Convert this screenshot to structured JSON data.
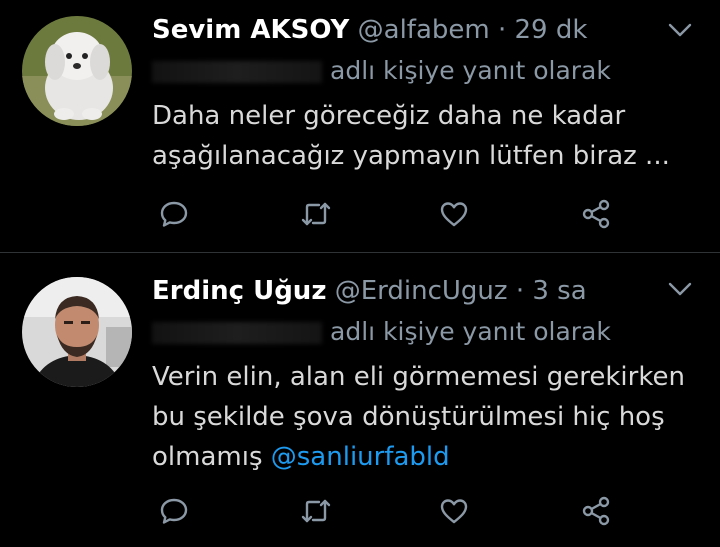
{
  "tweets": [
    {
      "name": "Sevim AKSOY",
      "handle": "@alfabem",
      "time": "29 dk",
      "reply_suffix": "adlı kişiye yanıt olarak",
      "body_lines": [
        "Daha neler göreceğiz daha ne kadar",
        "aşağılanacağız yapmayın lütfen biraz ..."
      ],
      "avatar_icon": "puppy-avatar"
    },
    {
      "name": "Erdinç Uğuz",
      "handle": "@ErdincUguz",
      "time": "3 sa",
      "reply_suffix": "adlı kişiye yanıt olarak",
      "body_lines": [
        "Verin elin, alan eli görmemesi gerekirken",
        "bu şekilde şova dönüştürülmesi hiç hoş",
        "olmamış"
      ],
      "mention": "@sanliurfabld",
      "avatar_icon": "man-avatar"
    }
  ],
  "separator": "·",
  "icons": [
    "reply-icon",
    "retweet-icon",
    "like-icon",
    "share-icon",
    "chevron-down-icon"
  ],
  "colors": {
    "background": "#000000",
    "text": "#d9d9d9",
    "muted": "#8b98a5",
    "link": "#1d9bf0",
    "divider": "#2f3336"
  }
}
